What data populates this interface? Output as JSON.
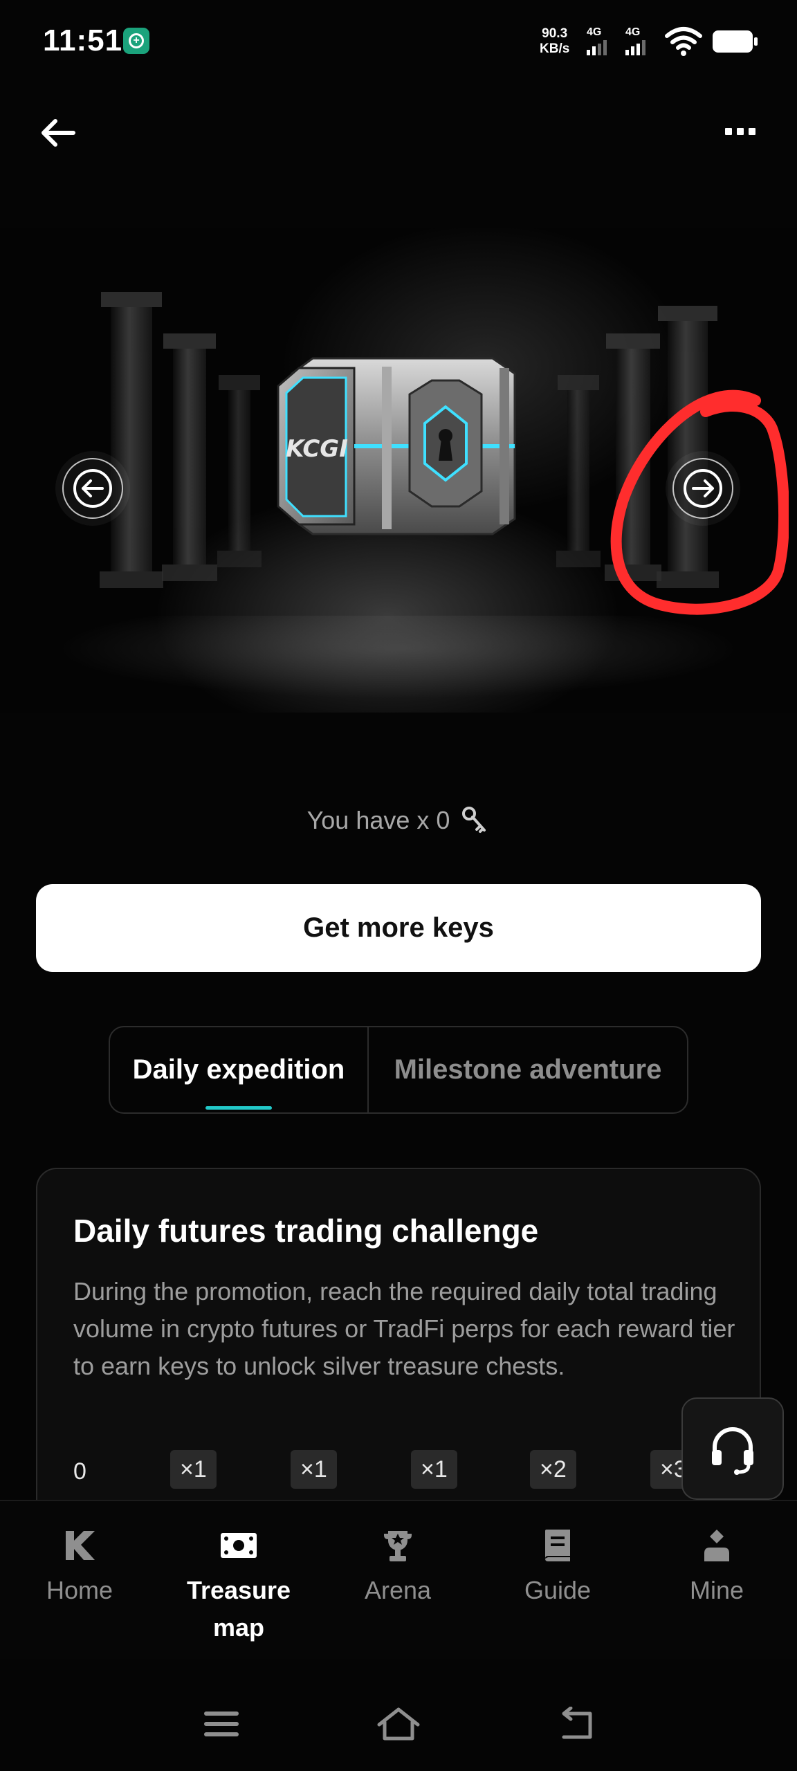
{
  "status_bar": {
    "time": "11:51",
    "net_speed_value": "90.3",
    "net_speed_unit": "KB/s",
    "signal_1_label": "4G",
    "signal_2_label": "4G",
    "badge_icon": "shield-plus-icon",
    "badge_color": "#1ba37c"
  },
  "header": {
    "back_icon": "arrow-left-icon",
    "more_icon": "more-dots-icon"
  },
  "hero": {
    "chest_label": "KCGI",
    "prev_icon": "arrow-left-circle-icon",
    "next_icon": "arrow-right-circle-icon",
    "annotation_color": "#ff2d2d",
    "accent_glow": "#3fe0ff"
  },
  "keys": {
    "text": "You have x 0",
    "icon": "key-icon"
  },
  "cta": {
    "label": "Get more keys"
  },
  "tabs": [
    {
      "label": "Daily expedition",
      "active": true
    },
    {
      "label": "Milestone adventure",
      "active": false
    }
  ],
  "tab_accent": "#22c9c9",
  "challenge": {
    "title": "Daily futures trading challenge",
    "description": "During the promotion, reach the required daily total trading volume in crypto futures or TradFi perps for each reward tier to earn keys to unlock silver treasure chests.",
    "tier_start": "0",
    "tiers": [
      "×1",
      "×1",
      "×1",
      "×2",
      "×3"
    ]
  },
  "support": {
    "icon": "headset-icon"
  },
  "bottom_nav": [
    {
      "label": "Home",
      "icon": "k-logo-icon",
      "active": false
    },
    {
      "label": "Treasure map",
      "icon": "treasure-map-icon",
      "active": true
    },
    {
      "label": "Arena",
      "icon": "trophy-icon",
      "active": false
    },
    {
      "label": "Guide",
      "icon": "book-icon",
      "active": false
    },
    {
      "label": "Mine",
      "icon": "user-icon",
      "active": false
    }
  ],
  "system_nav": {
    "menu_icon": "menu-icon",
    "home_icon": "home-icon",
    "back_icon": "back-icon"
  }
}
